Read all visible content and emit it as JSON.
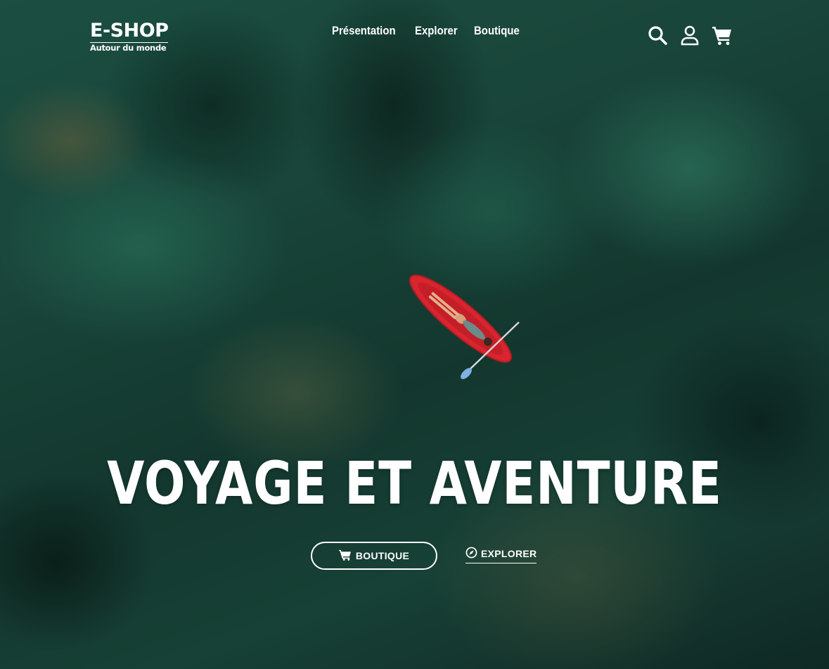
{
  "brand": {
    "name": "E-SHOP",
    "tagline": "Autour du monde"
  },
  "nav": {
    "items": [
      {
        "label": "Présentation"
      },
      {
        "label": "Explorer"
      },
      {
        "label": "Boutique"
      }
    ]
  },
  "header_icons": [
    "search-icon",
    "user-icon",
    "cart-icon"
  ],
  "hero": {
    "title": "VOYAGE ET AVENTURE",
    "primary_button": {
      "label": "BOUTIQUE",
      "icon": "cart-icon"
    },
    "secondary_link": {
      "label": "EXPLORER",
      "icon": "compass-icon"
    }
  },
  "colors": {
    "text": "#ffffff",
    "board": "#d8252f",
    "water": "#1d4f42"
  }
}
